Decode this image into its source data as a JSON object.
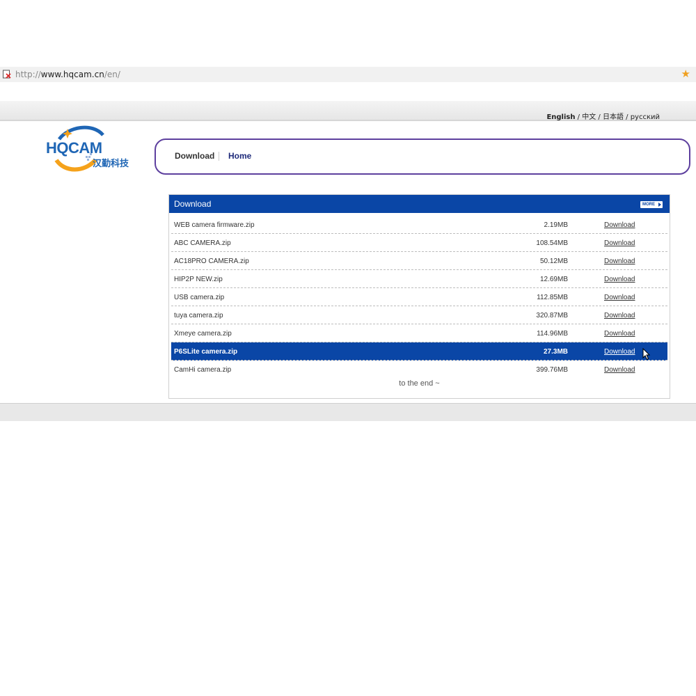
{
  "browser": {
    "url_prefix": "http://",
    "url_host": "www.hqcam.cn",
    "url_path": "/en/",
    "bookmark_icon": "star-icon",
    "site_icon": "page-warning-icon"
  },
  "languages": [
    "English",
    "中文",
    "日本語",
    "русский"
  ],
  "logo": {
    "text": "HQCAM",
    "subtext": "汉勤科技"
  },
  "nav": {
    "download": "Download",
    "home": "Home"
  },
  "download_section": {
    "title": "Download",
    "more_label": "MORE",
    "files": [
      {
        "name": "WEB camera firmware.zip",
        "size": "2.19MB",
        "link": "Download"
      },
      {
        "name": "ABC CAMERA.zip",
        "size": "108.54MB",
        "link": "Download"
      },
      {
        "name": "AC18PRO CAMERA.zip",
        "size": "50.12MB",
        "link": "Download"
      },
      {
        "name": "HIP2P NEW.zip",
        "size": "12.69MB",
        "link": "Download"
      },
      {
        "name": "USB camera.zip",
        "size": "112.85MB",
        "link": "Download"
      },
      {
        "name": "tuya camera.zip",
        "size": "320.87MB",
        "link": "Download"
      },
      {
        "name": "Xmeye camera.zip",
        "size": "114.96MB",
        "link": "Download"
      },
      {
        "name": "P6SLite camera.zip",
        "size": "27.3MB",
        "link": "Download"
      },
      {
        "name": "CamHi camera.zip",
        "size": "399.76MB",
        "link": "Download"
      }
    ],
    "highlighted_index": 7,
    "end_text": "to the end ~"
  },
  "colors": {
    "header_blue": "#0a46a6",
    "nav_border": "#5d3f9e",
    "logo_blue": "#1f66b5",
    "logo_orange": "#f5a21b"
  }
}
